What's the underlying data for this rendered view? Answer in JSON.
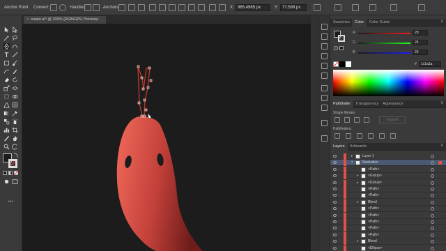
{
  "control_bar": {
    "anchor_point_label": "Anchor Point",
    "convert_label": "Convert:",
    "handles_label": "Handles:",
    "anchors_label": "Anchors:",
    "x_value": "965.4965 px",
    "y_value": "77.599 px"
  },
  "document": {
    "tab_title": "snake.ai* @ 200% (RGB/GPU Preview)"
  },
  "color_panel": {
    "tabs": [
      "Swatches",
      "Color",
      "Color Guide"
    ],
    "active_tab": "Color",
    "channels": [
      {
        "name": "R",
        "value": "28",
        "color": "#e04040"
      },
      {
        "name": "G",
        "value": "26",
        "color": "#40c040"
      },
      {
        "name": "B",
        "value": "26",
        "color": "#4060e0"
      }
    ],
    "hex_prefix": "#",
    "hex_value": "1c1a1a"
  },
  "pathfinder_panel": {
    "tabs": [
      "Pathfinder",
      "Transparency",
      "Appearance"
    ],
    "active_tab": "Pathfinder",
    "shape_modes_label": "Shape Modes:",
    "expand_label": "Expand",
    "pathfinders_label": "Pathfinders:"
  },
  "layers_panel": {
    "tabs": [
      "Layers",
      "Artboards"
    ],
    "active_tab": "Layers",
    "rows": [
      {
        "name": "Layer 1",
        "level": 0,
        "twirl": "▸",
        "selected": false
      },
      {
        "name": "Illustration",
        "level": 0,
        "twirl": "▾",
        "selected": true
      },
      {
        "name": "<Path>",
        "level": 1,
        "twirl": "",
        "selected": false
      },
      {
        "name": "<Group>",
        "level": 1,
        "twirl": "▸",
        "selected": false
      },
      {
        "name": "<Group>",
        "level": 1,
        "twirl": "▸",
        "selected": false
      },
      {
        "name": "<Path>",
        "level": 1,
        "twirl": "",
        "selected": false
      },
      {
        "name": "<Path>",
        "level": 1,
        "twirl": "",
        "selected": false
      },
      {
        "name": "Blend",
        "level": 1,
        "twirl": "▸",
        "selected": false
      },
      {
        "name": "<Path>",
        "level": 1,
        "twirl": "",
        "selected": false
      },
      {
        "name": "<Path>",
        "level": 1,
        "twirl": "",
        "selected": false
      },
      {
        "name": "<Path>",
        "level": 1,
        "twirl": "",
        "selected": false
      },
      {
        "name": "<Path>",
        "level": 1,
        "twirl": "",
        "selected": false
      },
      {
        "name": "<Path>",
        "level": 1,
        "twirl": "",
        "selected": false
      },
      {
        "name": "Blend",
        "level": 1,
        "twirl": "▸",
        "selected": false
      },
      {
        "name": "<Ellipse>",
        "level": 1,
        "twirl": "",
        "selected": false
      }
    ]
  },
  "colors": {
    "canvas_bg": "#1d1c1c",
    "snake_light": "#f26a5a",
    "snake_dark": "#7a1f1c",
    "tongue": "#c0392b",
    "layer_color": "#e2504a"
  }
}
